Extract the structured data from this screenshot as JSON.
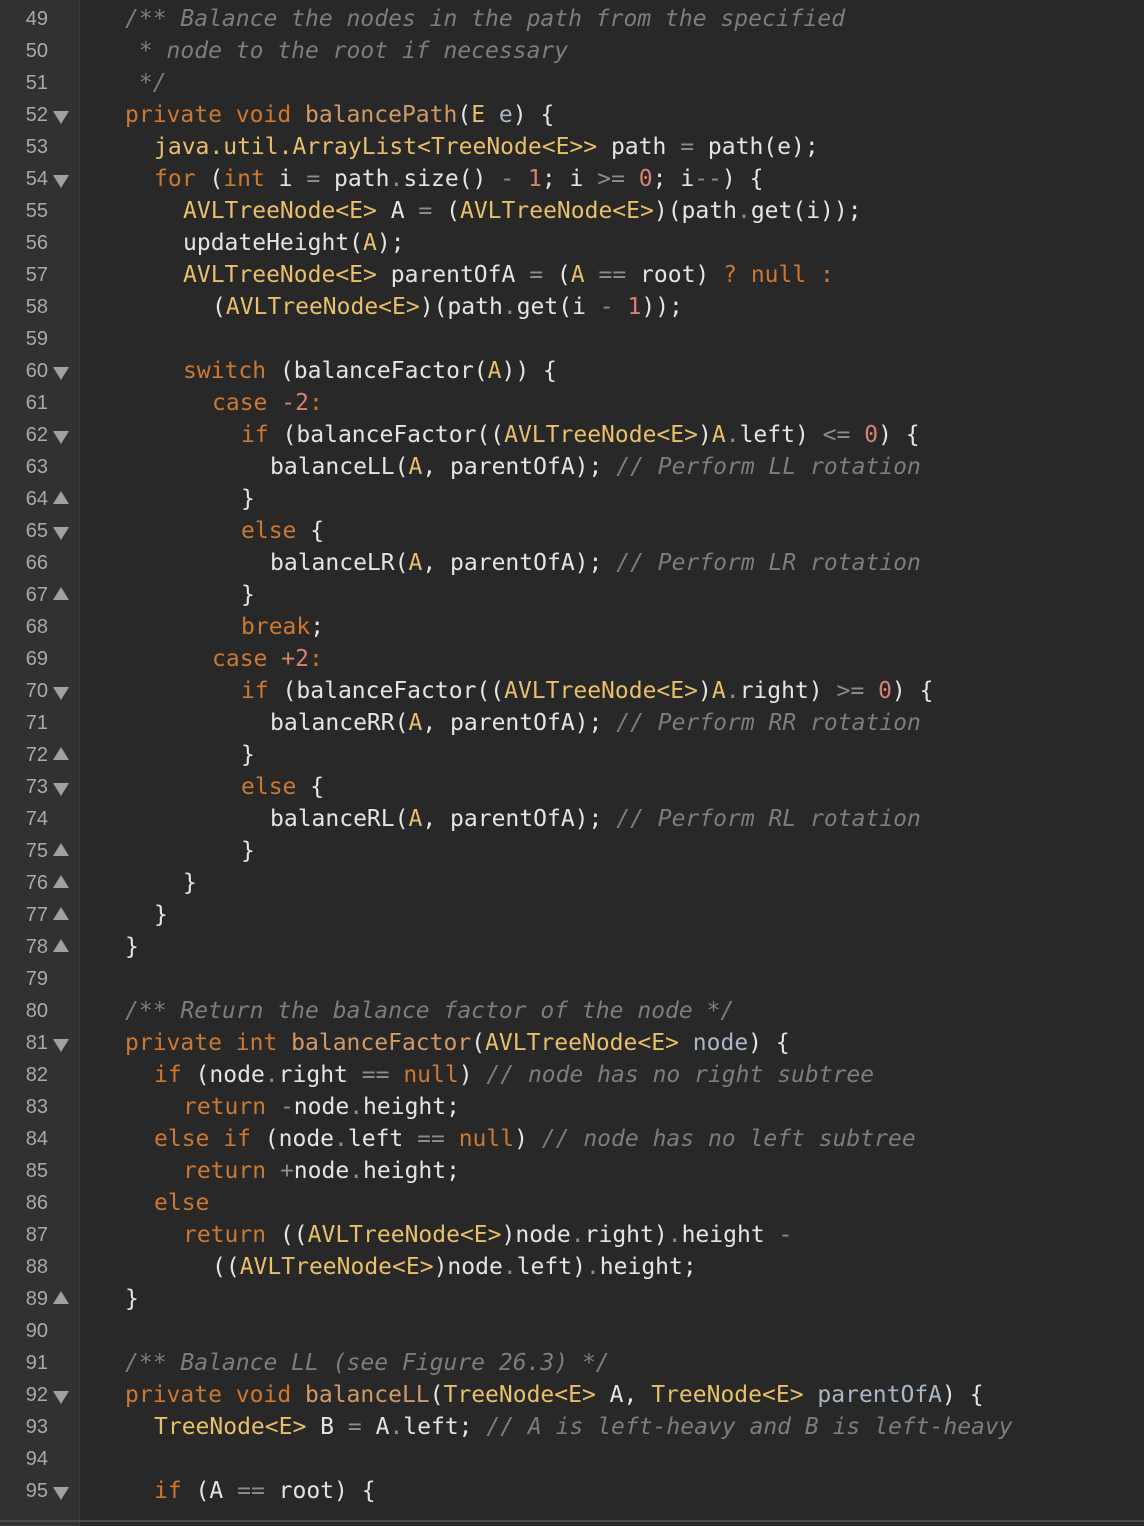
{
  "editor": {
    "lines": [
      {
        "num": "49",
        "fold": "",
        "indent": 0,
        "tokens": [
          [
            "c",
            "/** Balance the nodes in the path from the specified"
          ]
        ]
      },
      {
        "num": "50",
        "fold": "",
        "indent": 0,
        "tokens": [
          [
            "c",
            " * node to the root if necessary"
          ]
        ]
      },
      {
        "num": "51",
        "fold": "",
        "indent": 0,
        "tokens": [
          [
            "c",
            " */"
          ]
        ]
      },
      {
        "num": "52",
        "fold": "down",
        "indent": 0,
        "tokens": [
          [
            "k",
            "private void "
          ],
          [
            "f",
            "balancePath"
          ],
          [
            "x",
            "("
          ],
          [
            "t",
            "E"
          ],
          [
            "x",
            " "
          ],
          [
            "p",
            "e"
          ],
          [
            "x",
            ") {"
          ]
        ]
      },
      {
        "num": "53",
        "fold": "",
        "indent": 1,
        "tokens": [
          [
            "t",
            "java.util.ArrayList<TreeNode<E>>"
          ],
          [
            "x",
            " path "
          ],
          [
            "o",
            "="
          ],
          [
            "x",
            " path(e);"
          ]
        ]
      },
      {
        "num": "54",
        "fold": "down",
        "indent": 1,
        "tokens": [
          [
            "k",
            "for"
          ],
          [
            "x",
            " ("
          ],
          [
            "k",
            "int"
          ],
          [
            "x",
            " i "
          ],
          [
            "o",
            "="
          ],
          [
            "x",
            " path"
          ],
          [
            "o",
            "."
          ],
          [
            "x",
            "size() "
          ],
          [
            "o",
            "-"
          ],
          [
            "x",
            " "
          ],
          [
            "n",
            "1"
          ],
          [
            "x",
            "; i "
          ],
          [
            "o",
            ">="
          ],
          [
            "x",
            " "
          ],
          [
            "n",
            "0"
          ],
          [
            "x",
            "; i"
          ],
          [
            "o",
            "--"
          ],
          [
            "x",
            ") {"
          ]
        ]
      },
      {
        "num": "55",
        "fold": "",
        "indent": 2,
        "tokens": [
          [
            "t",
            "AVLTreeNode<E>"
          ],
          [
            "x",
            " A "
          ],
          [
            "o",
            "="
          ],
          [
            "x",
            " ("
          ],
          [
            "t",
            "AVLTreeNode<E>"
          ],
          [
            "x",
            ")(path"
          ],
          [
            "o",
            "."
          ],
          [
            "x",
            "get(i));"
          ]
        ]
      },
      {
        "num": "56",
        "fold": "",
        "indent": 2,
        "tokens": [
          [
            "x",
            "updateHeight("
          ],
          [
            "t",
            "A"
          ],
          [
            "x",
            ");"
          ]
        ]
      },
      {
        "num": "57",
        "fold": "",
        "indent": 2,
        "tokens": [
          [
            "t",
            "AVLTreeNode<E>"
          ],
          [
            "x",
            " parentOfA "
          ],
          [
            "o",
            "="
          ],
          [
            "x",
            " ("
          ],
          [
            "t",
            "A"
          ],
          [
            "x",
            " "
          ],
          [
            "o",
            "=="
          ],
          [
            "x",
            " root) "
          ],
          [
            "k",
            "? null :"
          ]
        ]
      },
      {
        "num": "58",
        "fold": "",
        "indent": 3,
        "tokens": [
          [
            "x",
            "("
          ],
          [
            "t",
            "AVLTreeNode<E>"
          ],
          [
            "x",
            ")(path"
          ],
          [
            "o",
            "."
          ],
          [
            "x",
            "get(i "
          ],
          [
            "o",
            "-"
          ],
          [
            "x",
            " "
          ],
          [
            "n",
            "1"
          ],
          [
            "x",
            "));"
          ]
        ]
      },
      {
        "num": "59",
        "fold": "",
        "indent": 0,
        "tokens": []
      },
      {
        "num": "60",
        "fold": "down",
        "indent": 2,
        "tokens": [
          [
            "k",
            "switch"
          ],
          [
            "x",
            " (balanceFactor("
          ],
          [
            "t",
            "A"
          ],
          [
            "x",
            ")) {"
          ]
        ]
      },
      {
        "num": "61",
        "fold": "",
        "indent": 3,
        "tokens": [
          [
            "k",
            "case "
          ],
          [
            "n",
            "-2"
          ],
          [
            "k",
            ":"
          ]
        ]
      },
      {
        "num": "62",
        "fold": "down",
        "indent": 4,
        "tokens": [
          [
            "k",
            "if"
          ],
          [
            "x",
            " (balanceFactor(("
          ],
          [
            "t",
            "AVLTreeNode<E>"
          ],
          [
            "x",
            ")"
          ],
          [
            "t",
            "A"
          ],
          [
            "o",
            "."
          ],
          [
            "x",
            "left) "
          ],
          [
            "o",
            "<="
          ],
          [
            "x",
            " "
          ],
          [
            "n",
            "0"
          ],
          [
            "x",
            ") {"
          ]
        ]
      },
      {
        "num": "63",
        "fold": "",
        "indent": 5,
        "tokens": [
          [
            "x",
            "balanceLL("
          ],
          [
            "t",
            "A"
          ],
          [
            "x",
            ", parentOfA); "
          ],
          [
            "c",
            "// Perform LL rotation"
          ]
        ]
      },
      {
        "num": "64",
        "fold": "up",
        "indent": 4,
        "tokens": [
          [
            "x",
            "}"
          ]
        ]
      },
      {
        "num": "65",
        "fold": "down",
        "indent": 4,
        "tokens": [
          [
            "k",
            "else"
          ],
          [
            "x",
            " {"
          ]
        ]
      },
      {
        "num": "66",
        "fold": "",
        "indent": 5,
        "tokens": [
          [
            "x",
            "balanceLR("
          ],
          [
            "t",
            "A"
          ],
          [
            "x",
            ", parentOfA); "
          ],
          [
            "c",
            "// Perform LR rotation"
          ]
        ]
      },
      {
        "num": "67",
        "fold": "up",
        "indent": 4,
        "tokens": [
          [
            "x",
            "}"
          ]
        ]
      },
      {
        "num": "68",
        "fold": "",
        "indent": 4,
        "tokens": [
          [
            "k",
            "break"
          ],
          [
            "x",
            ";"
          ]
        ]
      },
      {
        "num": "69",
        "fold": "",
        "indent": 3,
        "tokens": [
          [
            "k",
            "case "
          ],
          [
            "n",
            "+2"
          ],
          [
            "k",
            ":"
          ]
        ]
      },
      {
        "num": "70",
        "fold": "down",
        "indent": 4,
        "tokens": [
          [
            "k",
            "if"
          ],
          [
            "x",
            " (balanceFactor(("
          ],
          [
            "t",
            "AVLTreeNode<E>"
          ],
          [
            "x",
            ")"
          ],
          [
            "t",
            "A"
          ],
          [
            "o",
            "."
          ],
          [
            "x",
            "right) "
          ],
          [
            "o",
            ">="
          ],
          [
            "x",
            " "
          ],
          [
            "n",
            "0"
          ],
          [
            "x",
            ") {"
          ]
        ]
      },
      {
        "num": "71",
        "fold": "",
        "indent": 5,
        "tokens": [
          [
            "x",
            "balanceRR("
          ],
          [
            "t",
            "A"
          ],
          [
            "x",
            ", parentOfA); "
          ],
          [
            "c",
            "// Perform RR rotation"
          ]
        ]
      },
      {
        "num": "72",
        "fold": "up",
        "indent": 4,
        "tokens": [
          [
            "x",
            "}"
          ]
        ]
      },
      {
        "num": "73",
        "fold": "down",
        "indent": 4,
        "tokens": [
          [
            "k",
            "else"
          ],
          [
            "x",
            " {"
          ]
        ]
      },
      {
        "num": "74",
        "fold": "",
        "indent": 5,
        "tokens": [
          [
            "x",
            "balanceRL("
          ],
          [
            "t",
            "A"
          ],
          [
            "x",
            ", parentOfA); "
          ],
          [
            "c",
            "// Perform RL rotation"
          ]
        ]
      },
      {
        "num": "75",
        "fold": "up",
        "indent": 4,
        "tokens": [
          [
            "x",
            "}"
          ]
        ]
      },
      {
        "num": "76",
        "fold": "up",
        "indent": 2,
        "tokens": [
          [
            "x",
            "}"
          ]
        ]
      },
      {
        "num": "77",
        "fold": "up",
        "indent": 1,
        "tokens": [
          [
            "x",
            "}"
          ]
        ]
      },
      {
        "num": "78",
        "fold": "up",
        "indent": 0,
        "tokens": [
          [
            "x",
            "}"
          ]
        ]
      },
      {
        "num": "79",
        "fold": "",
        "indent": 0,
        "tokens": []
      },
      {
        "num": "80",
        "fold": "",
        "indent": 0,
        "tokens": [
          [
            "c",
            "/** Return the balance factor of the node */"
          ]
        ]
      },
      {
        "num": "81",
        "fold": "down",
        "indent": 0,
        "tokens": [
          [
            "k",
            "private int "
          ],
          [
            "f",
            "balanceFactor"
          ],
          [
            "x",
            "("
          ],
          [
            "t",
            "AVLTreeNode<E>"
          ],
          [
            "x",
            " "
          ],
          [
            "p",
            "node"
          ],
          [
            "x",
            ") {"
          ]
        ]
      },
      {
        "num": "82",
        "fold": "",
        "indent": 1,
        "tokens": [
          [
            "k",
            "if"
          ],
          [
            "x",
            " (node"
          ],
          [
            "o",
            "."
          ],
          [
            "x",
            "right "
          ],
          [
            "o",
            "=="
          ],
          [
            "x",
            " "
          ],
          [
            "k",
            "null"
          ],
          [
            "x",
            ") "
          ],
          [
            "c",
            "// node has no right subtree"
          ]
        ]
      },
      {
        "num": "83",
        "fold": "",
        "indent": 2,
        "tokens": [
          [
            "k",
            "return "
          ],
          [
            "o",
            "-"
          ],
          [
            "x",
            "node"
          ],
          [
            "o",
            "."
          ],
          [
            "x",
            "height;"
          ]
        ]
      },
      {
        "num": "84",
        "fold": "",
        "indent": 1,
        "tokens": [
          [
            "k",
            "else if"
          ],
          [
            "x",
            " (node"
          ],
          [
            "o",
            "."
          ],
          [
            "x",
            "left "
          ],
          [
            "o",
            "=="
          ],
          [
            "x",
            " "
          ],
          [
            "k",
            "null"
          ],
          [
            "x",
            ") "
          ],
          [
            "c",
            "// node has no left subtree"
          ]
        ]
      },
      {
        "num": "85",
        "fold": "",
        "indent": 2,
        "tokens": [
          [
            "k",
            "return "
          ],
          [
            "o",
            "+"
          ],
          [
            "x",
            "node"
          ],
          [
            "o",
            "."
          ],
          [
            "x",
            "height;"
          ]
        ]
      },
      {
        "num": "86",
        "fold": "",
        "indent": 1,
        "tokens": [
          [
            "k",
            "else"
          ]
        ]
      },
      {
        "num": "87",
        "fold": "",
        "indent": 2,
        "tokens": [
          [
            "k",
            "return"
          ],
          [
            "x",
            " (("
          ],
          [
            "t",
            "AVLTreeNode<E>"
          ],
          [
            "x",
            ")node"
          ],
          [
            "o",
            "."
          ],
          [
            "x",
            "right)"
          ],
          [
            "o",
            "."
          ],
          [
            "x",
            "height "
          ],
          [
            "o",
            "-"
          ]
        ]
      },
      {
        "num": "88",
        "fold": "",
        "indent": 3,
        "tokens": [
          [
            "x",
            "(("
          ],
          [
            "t",
            "AVLTreeNode<E>"
          ],
          [
            "x",
            ")node"
          ],
          [
            "o",
            "."
          ],
          [
            "x",
            "left)"
          ],
          [
            "o",
            "."
          ],
          [
            "x",
            "height;"
          ]
        ]
      },
      {
        "num": "89",
        "fold": "up",
        "indent": 0,
        "tokens": [
          [
            "x",
            "}"
          ]
        ]
      },
      {
        "num": "90",
        "fold": "",
        "indent": 0,
        "tokens": []
      },
      {
        "num": "91",
        "fold": "",
        "indent": 0,
        "tokens": [
          [
            "c",
            "/** Balance LL (see Figure 26.3) */"
          ]
        ]
      },
      {
        "num": "92",
        "fold": "down",
        "indent": 0,
        "tokens": [
          [
            "k",
            "private void "
          ],
          [
            "f",
            "balanceLL"
          ],
          [
            "x",
            "("
          ],
          [
            "t",
            "TreeNode<E>"
          ],
          [
            "x",
            " A, "
          ],
          [
            "t",
            "TreeNode<E>"
          ],
          [
            "x",
            " "
          ],
          [
            "p",
            "parentOfA"
          ],
          [
            "x",
            ") {"
          ]
        ]
      },
      {
        "num": "93",
        "fold": "",
        "indent": 1,
        "tokens": [
          [
            "t",
            "TreeNode<E>"
          ],
          [
            "x",
            " B "
          ],
          [
            "o",
            "="
          ],
          [
            "x",
            " A"
          ],
          [
            "o",
            "."
          ],
          [
            "x",
            "left; "
          ],
          [
            "c",
            "// A is left-heavy and B is left-heavy"
          ]
        ]
      },
      {
        "num": "94",
        "fold": "",
        "indent": 0,
        "tokens": []
      },
      {
        "num": "95",
        "fold": "down",
        "indent": 1,
        "tokens": [
          [
            "k",
            "if"
          ],
          [
            "x",
            " (A "
          ],
          [
            "o",
            "=="
          ],
          [
            "x",
            " root) {"
          ]
        ]
      }
    ]
  }
}
